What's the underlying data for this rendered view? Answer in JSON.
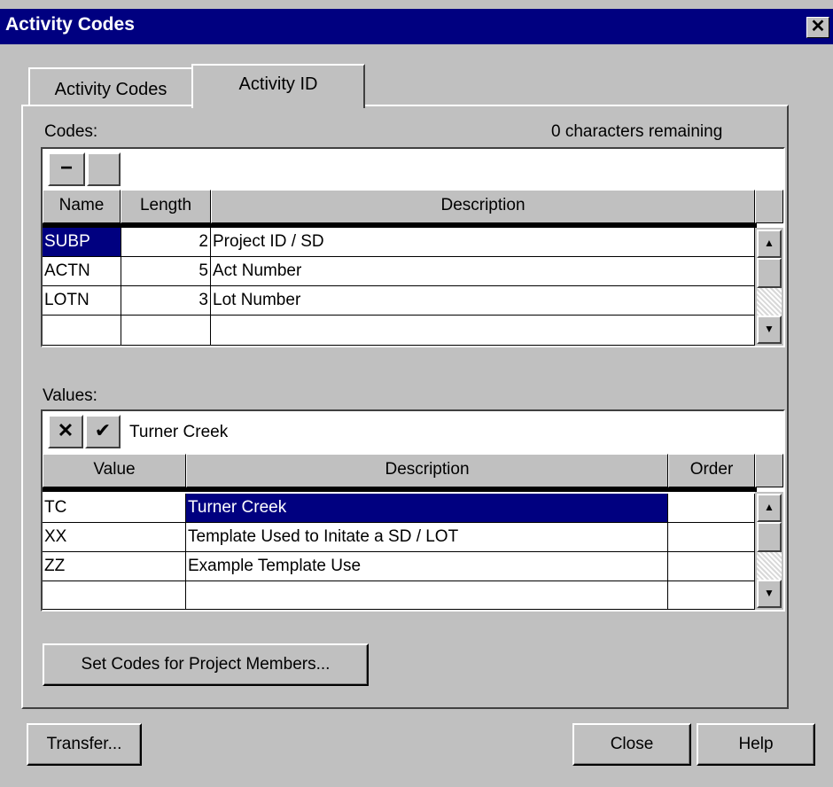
{
  "window": {
    "title": "Activity Codes",
    "close_glyph": "✕"
  },
  "tabs": [
    {
      "label": "Activity Codes"
    },
    {
      "label": "Activity ID"
    }
  ],
  "codes": {
    "label": "Codes:",
    "remaining": "0 characters remaining",
    "minus_glyph": "−",
    "edit_value": "",
    "columns": {
      "name": "Name",
      "length": "Length",
      "description": "Description"
    },
    "rows": [
      {
        "name": "SUBP",
        "length": "2",
        "description": "Project ID / SD"
      },
      {
        "name": "ACTN",
        "length": "5",
        "description": "Act Number"
      },
      {
        "name": "LOTN",
        "length": "3",
        "description": "Lot Number"
      },
      {
        "name": "",
        "length": "",
        "description": ""
      }
    ]
  },
  "values": {
    "label": "Values:",
    "cancel_glyph": "✕",
    "accept_glyph": "✔",
    "edit_value": "Turner Creek",
    "columns": {
      "value": "Value",
      "description": "Description",
      "order": "Order"
    },
    "rows": [
      {
        "value": "TC",
        "description": "Turner Creek",
        "order": ""
      },
      {
        "value": "XX",
        "description": "Template Used to Initate a SD / LOT",
        "order": ""
      },
      {
        "value": "ZZ",
        "description": "Example Template Use",
        "order": ""
      },
      {
        "value": "",
        "description": "",
        "order": ""
      }
    ]
  },
  "buttons": {
    "set_codes": "Set Codes for Project Members...",
    "transfer": "Transfer...",
    "close": "Close",
    "help": "Help"
  },
  "scroll": {
    "up": "▲",
    "down": "▼"
  },
  "colors": {
    "selection": "#000080",
    "face": "#c0c0c0",
    "title": "#000080"
  }
}
